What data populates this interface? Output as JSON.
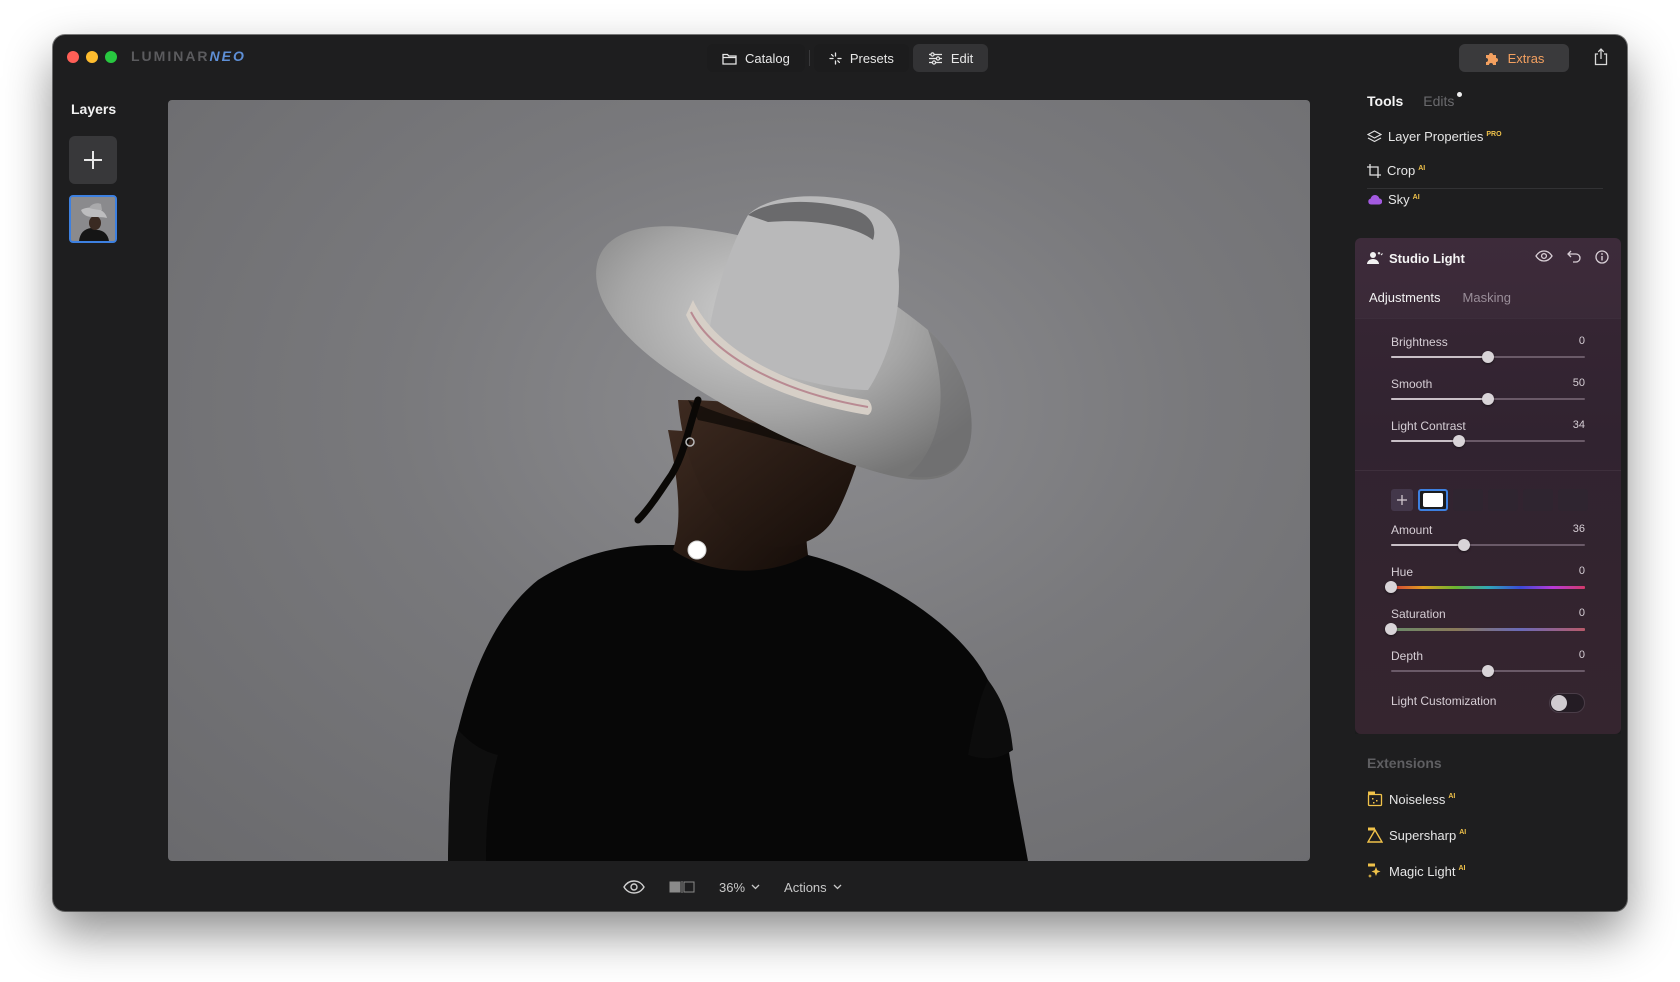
{
  "app": {
    "logo_part1": "LUMINAR",
    "logo_part2": "NEO"
  },
  "topnav": {
    "catalog": "Catalog",
    "presets": "Presets",
    "edit": "Edit",
    "active": "Edit"
  },
  "extras": {
    "label": "Extras"
  },
  "layers": {
    "title": "Layers"
  },
  "bottom_bar": {
    "zoom": "36%",
    "actions": "Actions"
  },
  "right_panel": {
    "tab_tools": "Tools",
    "tab_edits": "Edits",
    "tools": [
      {
        "label": "Layer Properties",
        "badge": "PRO",
        "icon": "layers-icon"
      },
      {
        "label": "Crop",
        "badge": "AI",
        "icon": "crop-icon"
      },
      {
        "label": "Sky",
        "badge": "AI",
        "icon": "cloud-icon"
      }
    ],
    "studio_light": {
      "title": "Studio Light",
      "tab_adjustments": "Adjustments",
      "tab_masking": "Masking",
      "brightness": {
        "label": "Brightness",
        "value": "0",
        "fraction": 0.5
      },
      "smooth": {
        "label": "Smooth",
        "value": "50",
        "fraction": 0.5
      },
      "light_contrast": {
        "label": "Light Contrast",
        "value": "34",
        "fraction": 0.35
      },
      "amount": {
        "label": "Amount",
        "value": "36",
        "fraction": 0.375
      },
      "hue": {
        "label": "Hue",
        "value": "0",
        "fraction": 0.0
      },
      "saturation": {
        "label": "Saturation",
        "value": "0",
        "fraction": 0.0
      },
      "depth": {
        "label": "Depth",
        "value": "0",
        "fraction": 0.5
      },
      "light_customization": {
        "label": "Light Customization",
        "on": false
      }
    },
    "extensions": {
      "title": "Extensions",
      "items": [
        {
          "label": "Noiseless",
          "badge": "AI",
          "icon": "noiseless-icon"
        },
        {
          "label": "Supersharp",
          "badge": "AI",
          "icon": "supersharp-icon"
        },
        {
          "label": "Magic Light",
          "badge": "AI",
          "icon": "magic-light-icon"
        }
      ]
    }
  },
  "colors": {
    "accent_blue": "#3d80e0",
    "extras_orange": "#f3a060",
    "studio_panel": "#3d2b3a",
    "badge_gold": "#f0c24a"
  }
}
